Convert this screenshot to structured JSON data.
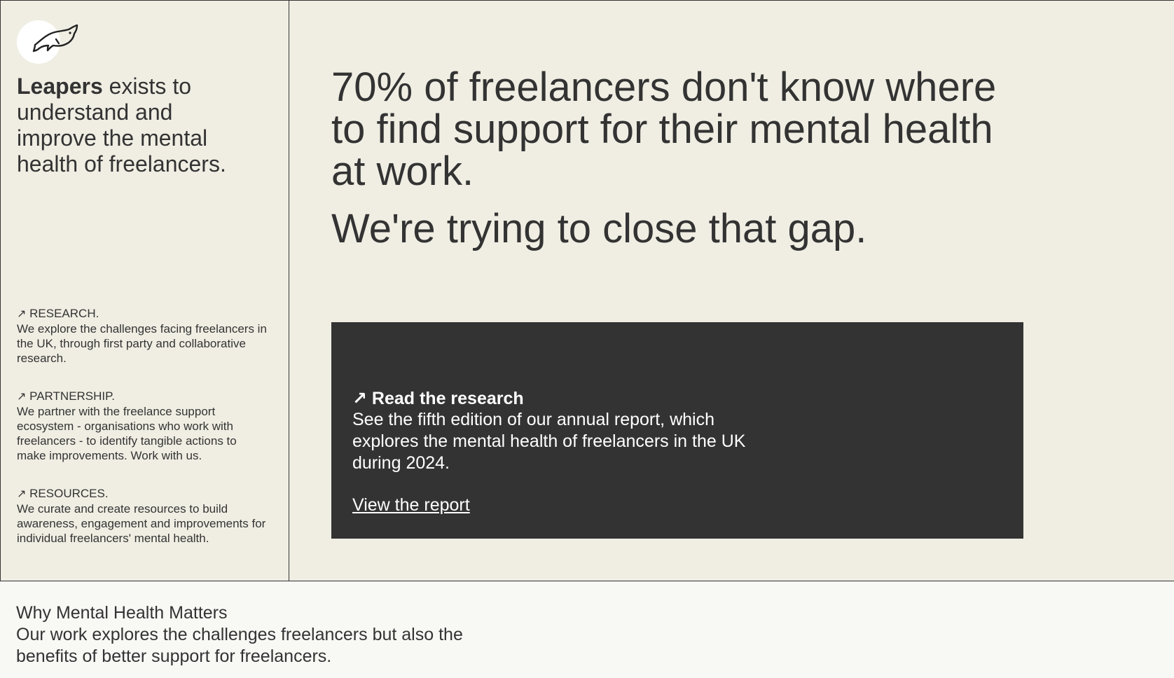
{
  "brand": {
    "name": "Leapers",
    "logo_icon": "fish-icon"
  },
  "sidebar": {
    "mission_rest": " exists to understand and improve the mental health of freelancers.",
    "pillars": [
      {
        "arrow": "↗",
        "title": "RESEARCH.",
        "text": "We explore the challenges facing freelancers in the UK, through first party and collaborative research."
      },
      {
        "arrow": "↗",
        "title": "PARTNERSHIP.",
        "text": "We partner with the freelance support ecosystem - organisations who work with freelancers - to identify tangible actions to make improvements. Work with us."
      },
      {
        "arrow": "↗",
        "title": "RESOURCES.",
        "text": "We curate and create resources to build awareness, engagement and improvements for individual freelancers' mental health."
      }
    ]
  },
  "main": {
    "headline": "70% of freelancers don't know where to find support for their mental health at work.",
    "subheadline": "We're trying to close that gap.",
    "card": {
      "title": "↗ Read the research",
      "text": "See the fifth edition of our annual report, which explores the mental health of freelancers in the UK during 2024.",
      "link": "View the report"
    }
  },
  "section": {
    "title": "Why Mental Health Matters",
    "text": "Our work explores the challenges freelancers but also the benefits of better support for freelancers."
  },
  "colors": {
    "background": "#f0eee3",
    "text": "#333333",
    "card": "#333333",
    "card_text": "#ffffff",
    "bottom_background": "#f8f8f5"
  }
}
